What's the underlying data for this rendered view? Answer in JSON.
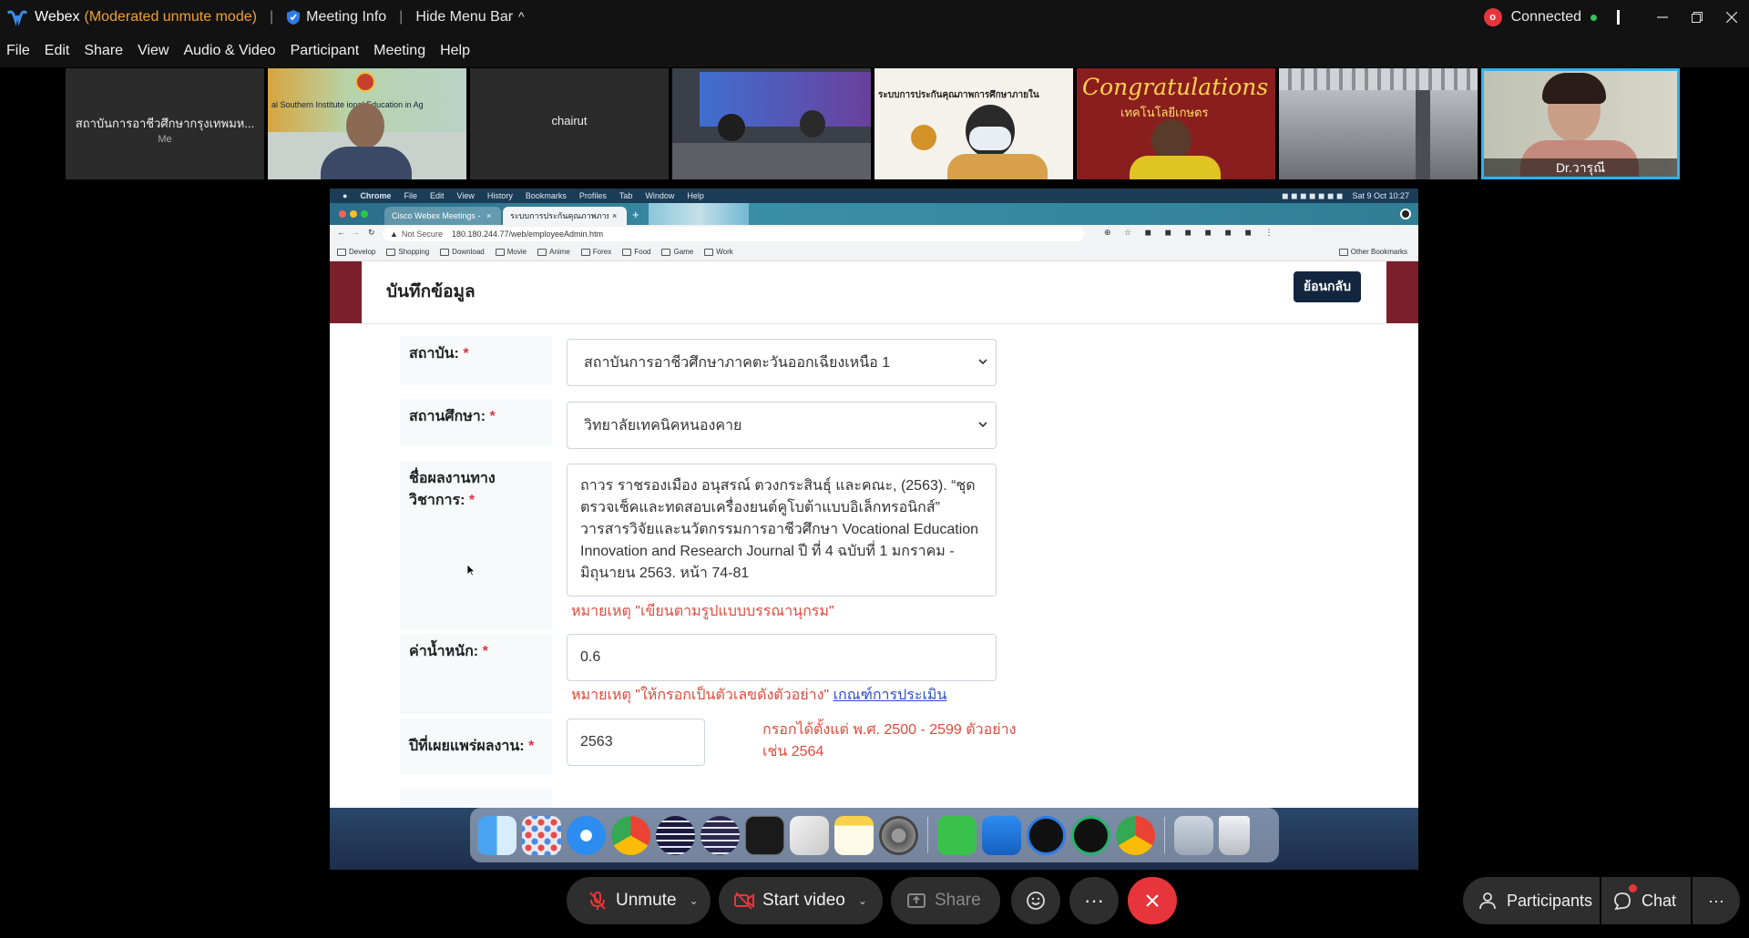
{
  "window": {
    "app_name": "Webex",
    "mode": "(Moderated unmute mode)",
    "meeting_info": "Meeting Info",
    "hide_menu": "Hide Menu Bar",
    "hide_menu_arrow": "^",
    "rec_badge": "o",
    "status": "Connected"
  },
  "menu": [
    "File",
    "Edit",
    "Share",
    "View",
    "Audio & Video",
    "Participant",
    "Meeting",
    "Help"
  ],
  "participants": [
    {
      "name": "สถาบันการอาชีวศึกษากรุงเทพมห...",
      "sub": "Me"
    },
    {
      "name": ""
    },
    {
      "name": "chairut"
    },
    {
      "name": ""
    },
    {
      "name": ""
    },
    {
      "name": ""
    },
    {
      "name": ""
    },
    {
      "name": "Dr.วารุณี"
    }
  ],
  "video_text": {
    "t2_banner": "al Southern Institute ional Education in Ag",
    "t5_banner": "ระบบการประกันคุณภาพการศึกษาภายใน",
    "t6_title": "Congratulations",
    "t6_sub": "เทคโนโลยีเกษตร"
  },
  "mac": {
    "menu": [
      "Chrome",
      "File",
      "Edit",
      "View",
      "History",
      "Bookmarks",
      "Profiles",
      "Tab",
      "Window",
      "Help"
    ],
    "datetime": "Sat 9 Oct  10:27"
  },
  "chrome": {
    "tab1": "Cisco Webex Meetings - Meet",
    "tab2": "ระบบการประกันคุณภาพภายในสถ",
    "not_secure": "Not Secure",
    "url": "180.180.244.77/web/employeeAdmin.htm",
    "bookmarks": [
      "Develop",
      "Shopping",
      "Download",
      "Movie",
      "Anime",
      "Forex",
      "Food",
      "Game",
      "Work"
    ],
    "other_bookmarks": "Other Bookmarks"
  },
  "page": {
    "title": "บันทึกข้อมูล",
    "back_button": "ย้อนกลับ",
    "req": "*",
    "fields": {
      "institute_label": "สถาบัน:",
      "institute_value": "สถาบันการอาชีวศึกษาภาคตะวันออกเฉียงเหนือ 1",
      "school_label": "สถานศึกษา:",
      "school_value": "วิทยาลัยเทคนิคหนองคาย",
      "work_label_1": "ชื่อผลงานทาง",
      "work_label_2": "วิชาการ:",
      "work_value": "ถาวร ราชรองเมือง อนุสรณ์ ตวงกระสินธุ์ และคณะ, (2563). “ชุดตรวจเช็คและทดสอบเครื่องยนต์คูโบต้าแบบอิเล็กทรอนิกส์” วารสารวิจัยและนวัตกรรมการอาชีวศึกษา Vocational Education Innovation and Research Journal ปี ที่ 4 ฉบับที่ 1 มกราคม - มิถุนายน 2563. หน้า 74-81",
      "work_note": "หมายเหตุ \"เขียนตามรูปแบบบรรณานุกรม\"",
      "weight_label": "ค่าน้ำหนัก:",
      "weight_value": "0.6",
      "weight_note": "หมายเหตุ \"ให้กรอกเป็นตัวเลขดังตัวอย่าง\"",
      "weight_link": "เกณฑ์การประเมิน",
      "year_label": "ปีที่เผยแพร่ผลงาน:",
      "year_value": "2563",
      "year_note": "กรอกได้ตั้งแต่ พ.ศ. 2500 - 2599 ตัวอย่าง เช่น 2564"
    }
  },
  "controls": {
    "unmute": "Unmute",
    "start_video": "Start video",
    "share": "Share",
    "more": "···",
    "participants": "Participants",
    "chat": "Chat",
    "overflow": "···"
  },
  "colors": {
    "accent_blue": "#29b6f6",
    "leave_red": "#e8353b",
    "page_band": "#7a1f2b",
    "back_button": "#12263f",
    "note_red": "#e04a3a"
  }
}
